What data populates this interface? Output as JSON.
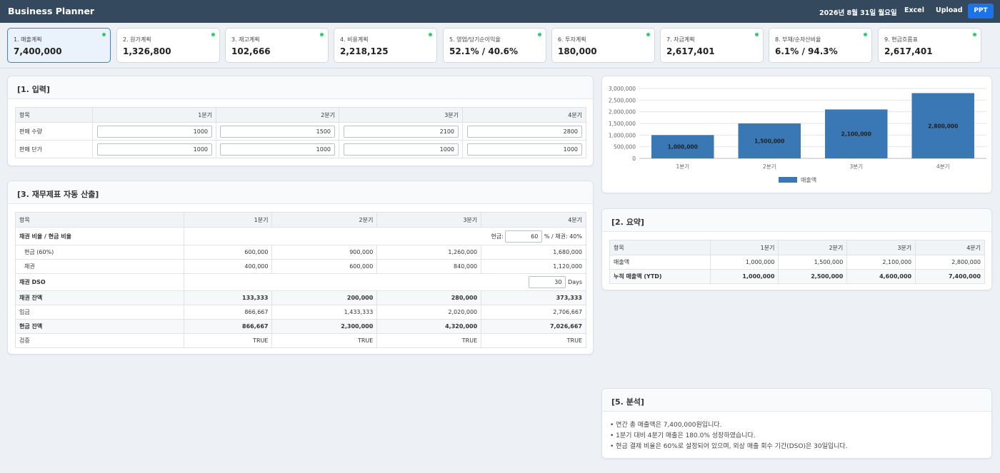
{
  "app": {
    "title": "Business Planner",
    "date": "2026년 8월 31일 월요일",
    "excel_label": "Excel",
    "upload_label": "Upload",
    "ppt_label": "PPT"
  },
  "tabs": [
    {
      "label": "1. 매출계획",
      "value": "7,400,000"
    },
    {
      "label": "2. 원가계획",
      "value": "1,326,800"
    },
    {
      "label": "3. 재고계획",
      "value": "102,666"
    },
    {
      "label": "4. 비용계획",
      "value": "2,218,125"
    },
    {
      "label": "5. 영업/당기순이익율",
      "value": "52.1% / 40.6%"
    },
    {
      "label": "6. 투자계획",
      "value": "180,000"
    },
    {
      "label": "7. 자금계획",
      "value": "2,617,401"
    },
    {
      "label": "8. 부채/순자산비율",
      "value": "6.1% / 94.3%"
    },
    {
      "label": "9. 현금흐름표",
      "value": "2,617,401"
    }
  ],
  "input_panel": {
    "title": "[1. 입력]",
    "header": [
      "항목",
      "1분기",
      "2분기",
      "3분기",
      "4분기"
    ],
    "rows": [
      {
        "label": "판매 수량",
        "values": [
          "1000",
          "1500",
          "2100",
          "2800"
        ]
      },
      {
        "label": "판매 단가",
        "values": [
          "1000",
          "1000",
          "1000",
          "1000"
        ]
      }
    ]
  },
  "finance_panel": {
    "title": "[3. 재무제표 자동 산출]",
    "header": [
      "항목",
      "1분기",
      "2분기",
      "3분기",
      "4분기"
    ],
    "ratio_row": {
      "label": "채권 비율 / 현금 비율",
      "cash_label": "현금:",
      "cash_value": "60",
      "suffix": "% / 채권: 40%"
    },
    "cash_row": {
      "label": "현금 (60%)",
      "values": [
        "600,000",
        "900,000",
        "1,260,000",
        "1,680,000"
      ]
    },
    "receivable_row": {
      "label": "채권",
      "values": [
        "400,000",
        "600,000",
        "840,000",
        "1,120,000"
      ]
    },
    "dso_row": {
      "label": "채권 DSO",
      "value": "30",
      "unit": "Days"
    },
    "receivable_balance": {
      "label": "채권 잔액",
      "values": [
        "133,333",
        "200,000",
        "280,000",
        "373,333"
      ]
    },
    "inflow": {
      "label": "입금",
      "values": [
        "866,667",
        "1,433,333",
        "2,020,000",
        "2,706,667"
      ]
    },
    "cash_balance": {
      "label": "현금 잔액",
      "values": [
        "866,667",
        "2,300,000",
        "4,320,000",
        "7,026,667"
      ]
    },
    "check": {
      "label": "검증",
      "values": [
        "TRUE",
        "TRUE",
        "TRUE",
        "TRUE"
      ]
    }
  },
  "chart_data": {
    "type": "bar",
    "categories": [
      "1분기",
      "2분기",
      "3분기",
      "4분기"
    ],
    "series": [
      {
        "name": "매출액",
        "values": [
          1000000,
          1500000,
          2100000,
          2800000
        ]
      }
    ],
    "data_labels": [
      "1,000,000",
      "1,500,000",
      "2,100,000",
      "2,800,000"
    ],
    "y_ticks": [
      "0",
      "500,000",
      "1,000,000",
      "1,500,000",
      "2,000,000",
      "2,500,000",
      "3,000,000"
    ],
    "ylim": [
      0,
      3000000
    ],
    "legend": "bottom",
    "grid": true,
    "color": "#3a78b5"
  },
  "summary_panel": {
    "title": "[2. 요약]",
    "header": [
      "항목",
      "1분기",
      "2분기",
      "3분기",
      "4분기"
    ],
    "rows": [
      {
        "label": "매출액",
        "values": [
          "1,000,000",
          "1,500,000",
          "2,100,000",
          "2,800,000"
        ]
      },
      {
        "label": "누적 매출액 (YTD)",
        "values": [
          "1,000,000",
          "2,500,000",
          "4,600,000",
          "7,400,000"
        ]
      }
    ]
  },
  "analysis_panel": {
    "title": "[5. 분석]",
    "lines": [
      "• 연간 총 매출액은 7,400,000원입니다.",
      "• 1분기 대비 4분기 매출은 180.0% 성장하였습니다.",
      "• 현금 결제 비율은 60%로 설정되어 있으며, 외상 매출 회수 기간(DSO)은 30일입니다."
    ]
  },
  "colors": {
    "topbar": "#34495e",
    "accent": "#1a73e8",
    "status_dot": "#2ecc71",
    "true_text": "#27ae60"
  }
}
